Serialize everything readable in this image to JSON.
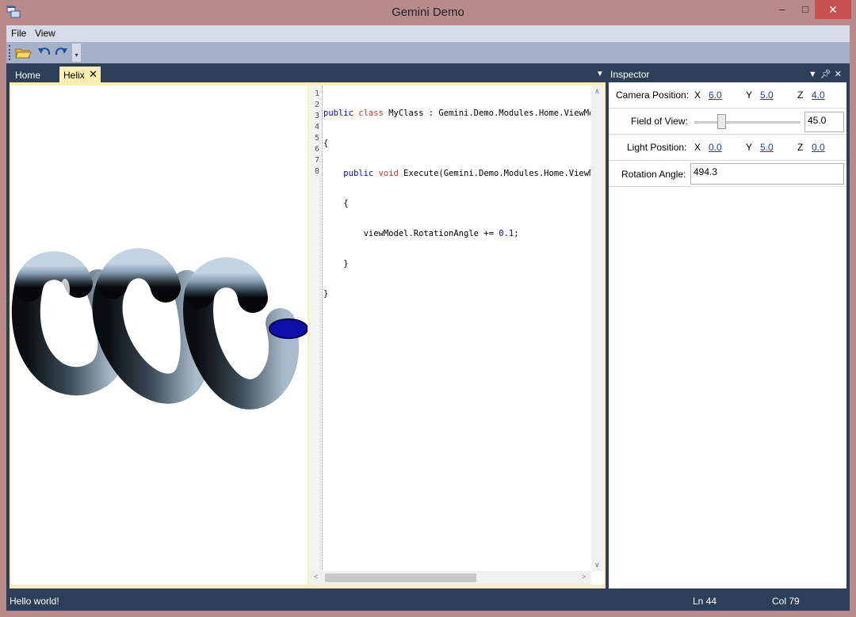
{
  "window": {
    "title": "Gemini Demo"
  },
  "menu": {
    "file": "File",
    "view": "View"
  },
  "tabs": [
    {
      "label": "Home"
    },
    {
      "label": "Helix"
    }
  ],
  "inspector": {
    "title": "Inspector",
    "camera_position": {
      "label": "Camera Position:",
      "x_label": "X",
      "x": "6.0",
      "y_label": "Y",
      "y": "5.0",
      "z_label": "Z",
      "z": "4.0"
    },
    "field_of_view": {
      "label": "Field of View:",
      "value": "45.0",
      "slider_fraction": 0.25
    },
    "light_position": {
      "label": "Light Position:",
      "x_label": "X",
      "x": "0.0",
      "y_label": "Y",
      "y": "5.0",
      "z_label": "Z",
      "z": "0.0"
    },
    "rotation_angle": {
      "label": "Rotation Angle:",
      "value": "494.3"
    }
  },
  "editor": {
    "line_numbers": [
      "1",
      "2",
      "3",
      "4",
      "5",
      "6",
      "7",
      "8"
    ],
    "lines": [
      {
        "k1": "public",
        "k2": "class",
        "rest": " MyClass : Gemini.Demo.Modules.Home.ViewModels"
      },
      {
        "text": "{"
      },
      {
        "pre": "    ",
        "k1": "public",
        "k2": "void",
        "rest": " Execute(Gemini.Demo.Modules.Home.ViewModels"
      },
      {
        "text": "    {"
      },
      {
        "pre": "        viewModel.RotationAngle += ",
        "num": "0.1",
        "post": ";"
      },
      {
        "text": "    }"
      },
      {
        "text": "}"
      },
      {
        "text": ""
      }
    ]
  },
  "status": {
    "message": "Hello world!",
    "line": "Ln 44",
    "column": "Col 79"
  },
  "colors": {
    "chrome": "#2d3e58",
    "tab_active": "#fdefb2",
    "window_border": "#b98a8a",
    "link": "#1a3fc2"
  },
  "icons": [
    "app-icon",
    "open-folder-icon",
    "undo-icon",
    "redo-icon",
    "minimize-icon",
    "maximize-icon",
    "close-icon",
    "pin-icon",
    "dropdown-icon"
  ]
}
